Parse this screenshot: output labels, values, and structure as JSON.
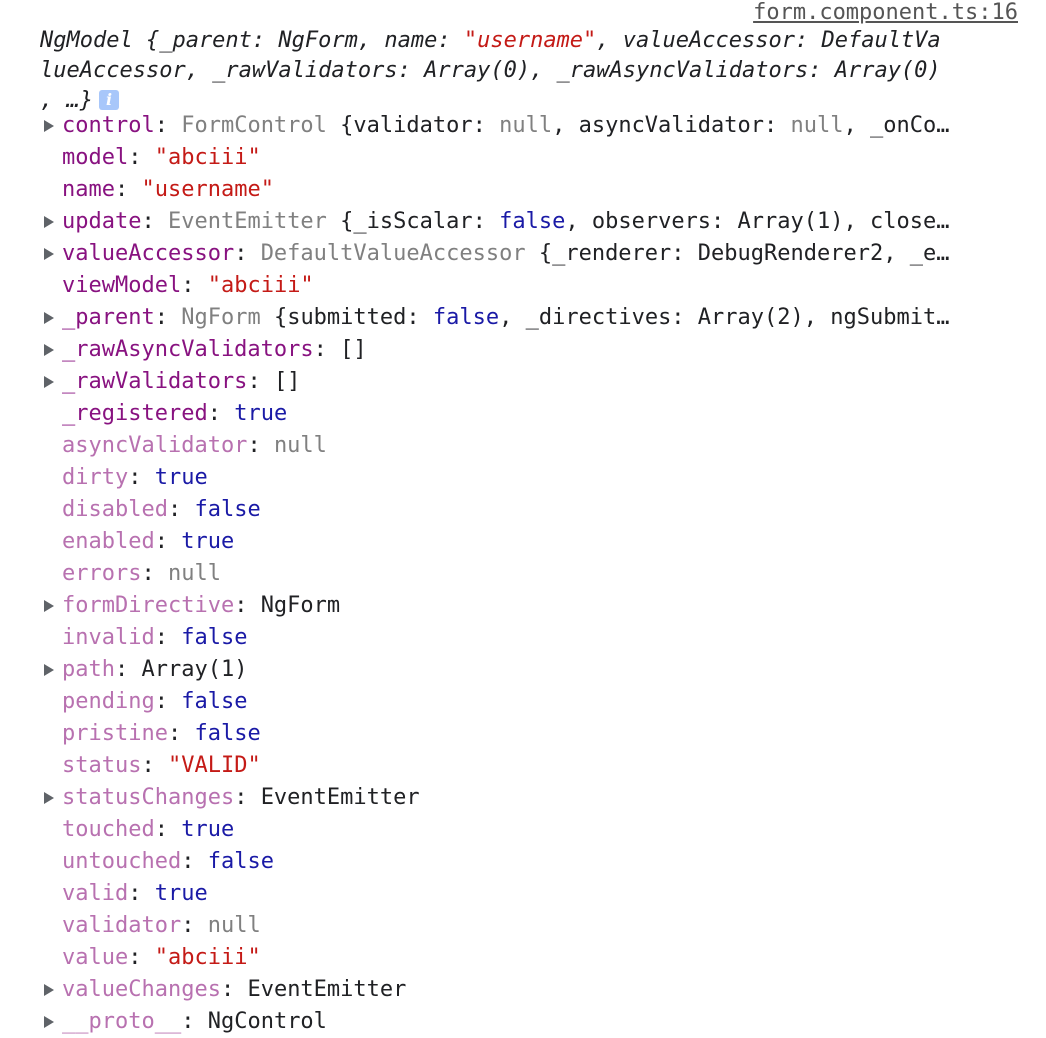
{
  "source_link": "form.component.ts:16",
  "summary": {
    "line1": "NgModel {_parent: NgForm, name: ",
    "line1_name": "\"username\"",
    "line1_rest": ", valueAccessor: DefaultVa",
    "line2": "lueAccessor, _rawValidators: Array(0), _rawAsyncValidators: Array(0)",
    "line3": ", …}",
    "info_glyph": "i"
  },
  "colors": {
    "own_key": "#881280",
    "inherited_key": "#b871b0",
    "string": "#c41a16",
    "boolean": "#1a1aa6",
    "null": "#808080"
  },
  "rows": [
    {
      "key": "control",
      "sep": ": ",
      "v1": "FormControl",
      "v2": " {validator: ",
      "v3": "null",
      "v4": ", asyncValidator: ",
      "v5": "null",
      "v6": ", _onCo…"
    },
    {
      "key": "model",
      "sep": ": ",
      "value": "\"abciii\""
    },
    {
      "key": "name",
      "sep": ": ",
      "value": "\"username\""
    },
    {
      "key": "update",
      "sep": ": ",
      "v1": "EventEmitter",
      "v2": " {_isScalar: ",
      "v3": "false",
      "v4": ", observers: Array(1), close…"
    },
    {
      "key": "valueAccessor",
      "sep": ": ",
      "v1": "DefaultValueAccessor",
      "v2": " {_renderer: DebugRenderer2, _e…"
    },
    {
      "key": "viewModel",
      "sep": ": ",
      "value": "\"abciii\""
    },
    {
      "key": "_parent",
      "sep": ": ",
      "v1": "NgForm",
      "v2": " {submitted: ",
      "v3": "false",
      "v4": ", _directives: Array(2), ngSubmit…"
    },
    {
      "key": "_rawAsyncValidators",
      "sep": ": ",
      "value": "[]"
    },
    {
      "key": "_rawValidators",
      "sep": ": ",
      "value": "[]"
    },
    {
      "key": "_registered",
      "sep": ": ",
      "value": "true"
    },
    {
      "key": "asyncValidator",
      "sep": ": ",
      "value": "null"
    },
    {
      "key": "dirty",
      "sep": ": ",
      "value": "true"
    },
    {
      "key": "disabled",
      "sep": ": ",
      "value": "false"
    },
    {
      "key": "enabled",
      "sep": ": ",
      "value": "true"
    },
    {
      "key": "errors",
      "sep": ": ",
      "value": "null"
    },
    {
      "key": "formDirective",
      "sep": ": ",
      "value": "NgForm"
    },
    {
      "key": "invalid",
      "sep": ": ",
      "value": "false"
    },
    {
      "key": "path",
      "sep": ": ",
      "value": "Array(1)"
    },
    {
      "key": "pending",
      "sep": ": ",
      "value": "false"
    },
    {
      "key": "pristine",
      "sep": ": ",
      "value": "false"
    },
    {
      "key": "status",
      "sep": ": ",
      "value": "\"VALID\""
    },
    {
      "key": "statusChanges",
      "sep": ": ",
      "value": "EventEmitter"
    },
    {
      "key": "touched",
      "sep": ": ",
      "value": "true"
    },
    {
      "key": "untouched",
      "sep": ": ",
      "value": "false"
    },
    {
      "key": "valid",
      "sep": ": ",
      "value": "true"
    },
    {
      "key": "validator",
      "sep": ": ",
      "value": "null"
    },
    {
      "key": "value",
      "sep": ": ",
      "value": "\"abciii\""
    },
    {
      "key": "valueChanges",
      "sep": ": ",
      "value": "EventEmitter"
    },
    {
      "key": "__proto__",
      "sep": ": ",
      "value": "NgControl"
    }
  ]
}
